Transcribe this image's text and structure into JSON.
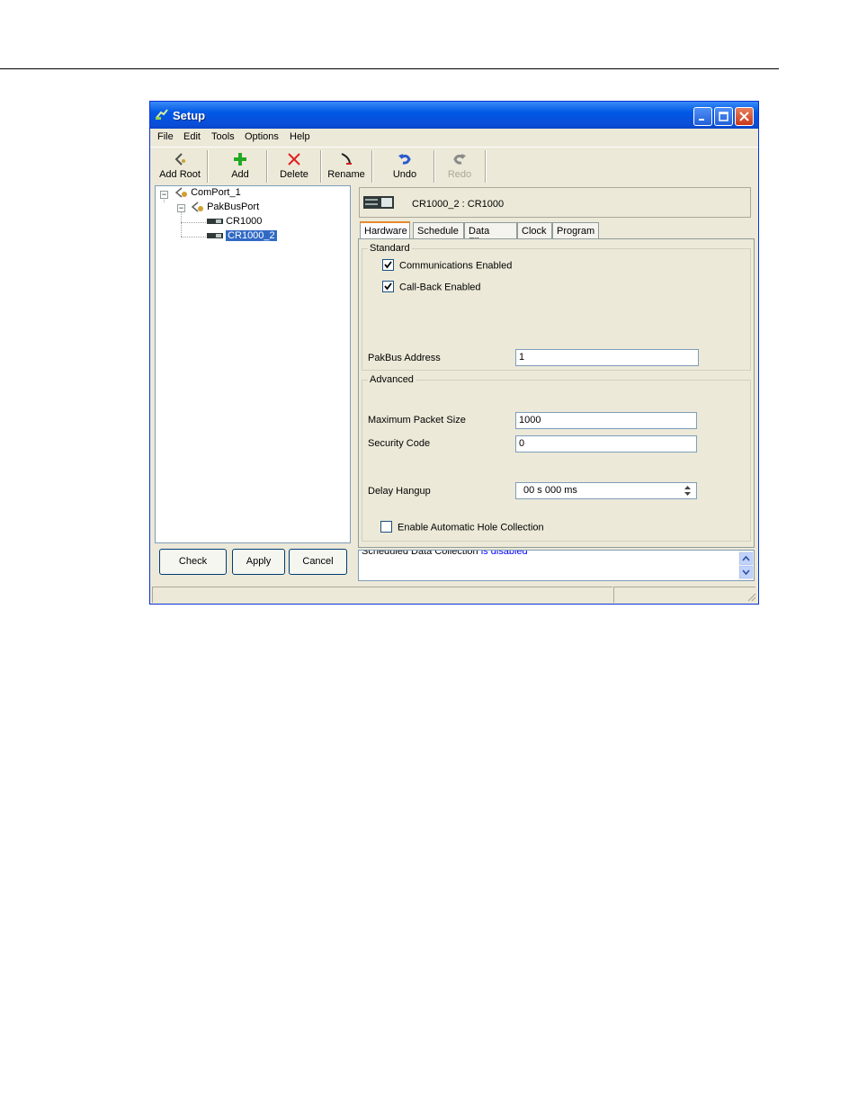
{
  "window": {
    "title": "Setup"
  },
  "menu": [
    "File",
    "Edit",
    "Tools",
    "Options",
    "Help"
  ],
  "toolbar": {
    "add_root": "Add Root",
    "add": "Add",
    "delete": "Delete",
    "rename": "Rename",
    "undo": "Undo",
    "redo": "Redo"
  },
  "tree": {
    "root": "ComPort_1",
    "child": "PakBusPort",
    "leaves": [
      "CR1000",
      "CR1000_2"
    ],
    "selected": "CR1000_2"
  },
  "buttons": {
    "check": "Check",
    "apply": "Apply",
    "cancel": "Cancel"
  },
  "device_header": "CR1000_2 : CR1000",
  "tabs": [
    "Hardware",
    "Schedule",
    "Data Files",
    "Clock",
    "Program"
  ],
  "active_tab": "Hardware",
  "standard": {
    "title": "Standard",
    "comm_enabled": {
      "label": "Communications Enabled",
      "checked": true
    },
    "callback_enabled": {
      "label": "Call-Back Enabled",
      "checked": true
    },
    "pakbus_label": "PakBus Address",
    "pakbus_value": "1"
  },
  "advanced": {
    "title": "Advanced",
    "max_packet_label": "Maximum Packet Size",
    "max_packet_value": "1000",
    "security_label": "Security Code",
    "security_value": "0",
    "delay_label": "Delay Hangup",
    "delay_value": "00 s 000 ms",
    "hole_collection": {
      "label": "Enable Automatic Hole Collection",
      "checked": false
    }
  },
  "status": {
    "prefix": "Scheduled Data Collection",
    "suffix": "is disabled"
  },
  "colors": {
    "titlebar": "#0058e6",
    "selection": "#316ac5",
    "link": "#0000ff"
  }
}
